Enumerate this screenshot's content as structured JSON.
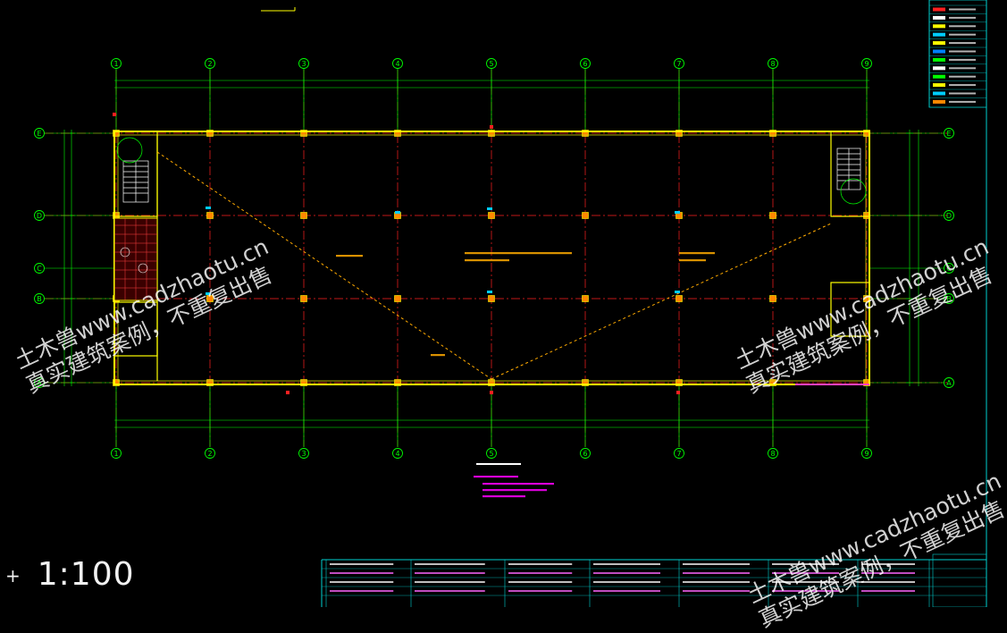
{
  "drawing": {
    "axis_labels": [
      "1",
      "2",
      "3",
      "4",
      "5",
      "6",
      "7",
      "8",
      "9"
    ],
    "row_labels": [
      "E",
      "D",
      "C",
      "B",
      "A"
    ],
    "scale_text": "1:100"
  },
  "watermarks": [
    {
      "line1": "土木兽www.cadzhaotu.cn",
      "line2": "真实建筑案例，不重复出售"
    },
    {
      "line1": "土木兽www.cadzhaotu.cn",
      "line2": "真实建筑案例，不重复出售"
    },
    {
      "line1": "土木兽www.cadzhaotu.cn",
      "line2": "真实建筑案例，不重复出售"
    }
  ],
  "colors": {
    "background": "#000000",
    "axis_green": "#00ff00",
    "grid_red": "#ff2020",
    "wall_yellow": "#ffff00",
    "accent_magenta": "#ff00ff",
    "cyan": "#00ffff",
    "slope_orange": "#ffaa00"
  }
}
